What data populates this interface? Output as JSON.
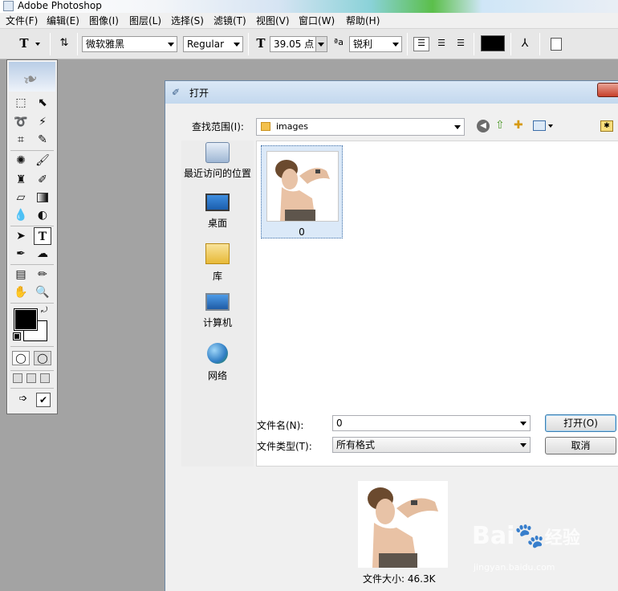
{
  "app": {
    "title": "Adobe Photoshop"
  },
  "menu": [
    "文件(F)",
    "编辑(E)",
    "图像(I)",
    "图层(L)",
    "选择(S)",
    "滤镜(T)",
    "视图(V)",
    "窗口(W)",
    "帮助(H)"
  ],
  "options": {
    "tool_glyph": "T",
    "font_family": "微软雅黑",
    "font_style": "Regular",
    "font_size": "39.05 点",
    "aa_label": "a",
    "aa_value": "锐利",
    "color": "#000000"
  },
  "dialog": {
    "title": "打开",
    "lookin_label": "查找范围(I):",
    "lookin_value": "images",
    "places": [
      "最近访问的位置",
      "桌面",
      "库",
      "计算机",
      "网络"
    ],
    "files": [
      {
        "name": "0"
      }
    ],
    "filename_label": "文件名(N):",
    "filename_value": "0",
    "filetype_label": "文件类型(T):",
    "filetype_value": "所有格式",
    "open_label": "打开(O)",
    "cancel_label": "取消",
    "filesize": "文件大小: 46.3K"
  },
  "watermark": {
    "brand": "Bai",
    "brand_suffix": "经验",
    "url": "jingyan.baidu.com"
  }
}
